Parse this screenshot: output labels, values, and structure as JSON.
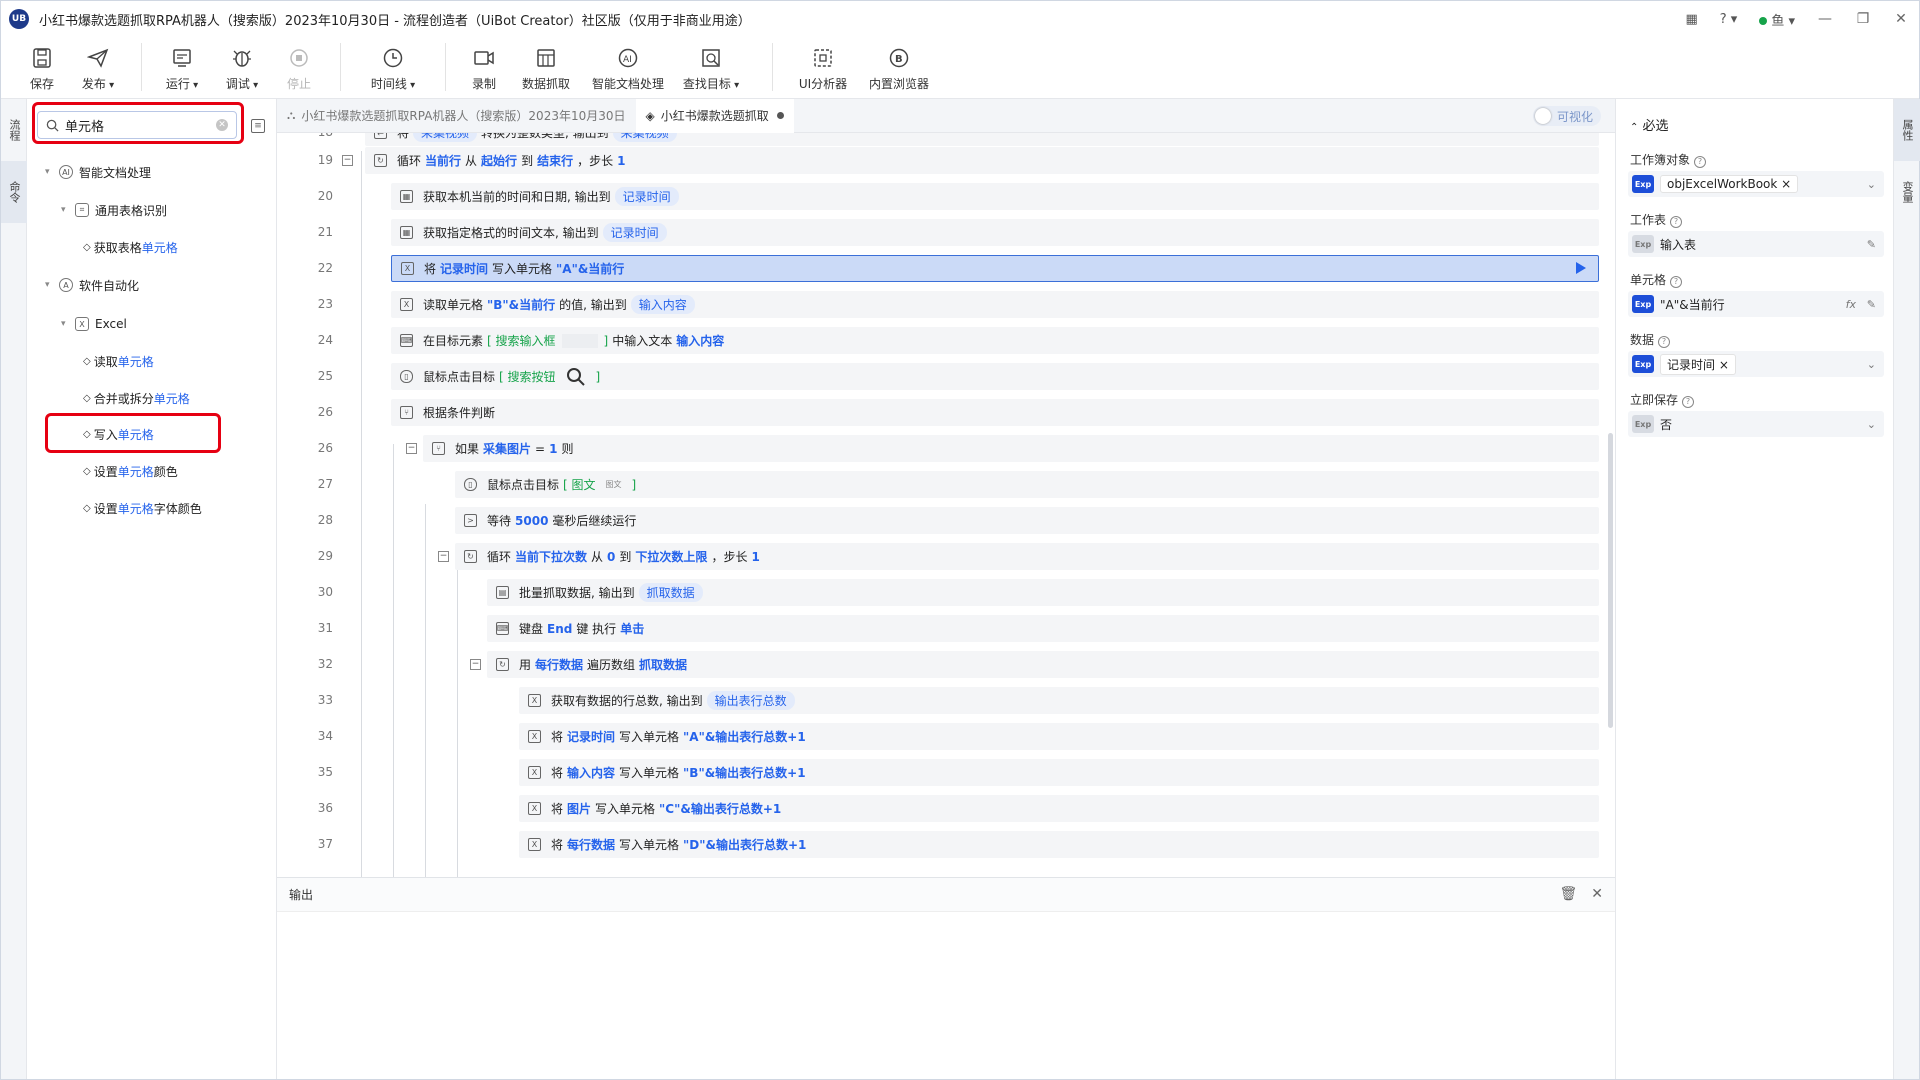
{
  "window": {
    "logo": "UB",
    "title": "小红书爆款选题抓取RPA机器人（搜索版）2023年10月30日 - 流程创造者（UiBot Creator）社区版（仅用于非商业用途）",
    "user": "鱼",
    "help": "?"
  },
  "toolbar": {
    "save": "保存",
    "publish": "发布",
    "run": "运行",
    "debug": "调试",
    "stop": "停止",
    "timeline": "时间线",
    "record": "录制",
    "data_scrape": "数据抓取",
    "smart_doc": "智能文档处理",
    "find_target": "查找目标",
    "ui_analyzer": "UI分析器",
    "browser": "内置浏览器"
  },
  "left_strip": {
    "tab1": "流程",
    "tab2": "命令"
  },
  "right_strip": {
    "tab1": "属性",
    "tab2": "变量"
  },
  "search": {
    "value": "单元格"
  },
  "tree": [
    {
      "id": "t1",
      "prefix": "智能文档处理",
      "highlight": "",
      "suffix": ""
    },
    {
      "id": "t2",
      "prefix": "通用表格识别",
      "highlight": "",
      "suffix": ""
    },
    {
      "id": "t3",
      "prefix": "获取表格",
      "highlight": "单元格",
      "suffix": ""
    },
    {
      "id": "t4",
      "prefix": "软件自动化",
      "highlight": "",
      "suffix": ""
    },
    {
      "id": "t5",
      "prefix": "Excel",
      "highlight": "",
      "suffix": ""
    },
    {
      "id": "t6",
      "prefix": "读取",
      "highlight": "单元格",
      "suffix": ""
    },
    {
      "id": "t7",
      "prefix": "合并或拆分",
      "highlight": "单元格",
      "suffix": ""
    },
    {
      "id": "t8",
      "prefix": "写入",
      "highlight": "单元格",
      "suffix": ""
    },
    {
      "id": "t9",
      "prefix": "设置",
      "highlight": "单元格",
      "suffix": "颜色"
    },
    {
      "id": "t10",
      "prefix": "设置",
      "highlight": "单元格",
      "suffix": "字体颜色"
    }
  ],
  "tabs": {
    "main": "小红书爆款选题抓取RPA机器人（搜索版）2023年10月30日",
    "sub": "小红书爆款选题抓取",
    "visual": "可视化"
  },
  "code": {
    "r18": {
      "ln": "18",
      "a": "将",
      "v1": "采集视频",
      "b": "转换为整数类型, 输出到",
      "v2": "采集视频"
    },
    "r19": {
      "ln": "19",
      "a": "循环",
      "k1": "当前行",
      "b": "从",
      "k2": "起始行",
      "c": "到",
      "k3": "结束行",
      "d": "，步长",
      "k4": "1"
    },
    "r20": {
      "ln": "20",
      "a": "获取本机当前的时间和日期, 输出到",
      "v1": "记录时间"
    },
    "r21": {
      "ln": "21",
      "a": "获取指定格式的时间文本, 输出到",
      "v1": "记录时间"
    },
    "r22": {
      "ln": "22",
      "a": "将",
      "k1": "记录时间",
      "b": "写入单元格",
      "k2": "\"A\"&当前行"
    },
    "r23": {
      "ln": "23",
      "a": "读取单元格",
      "k1": "\"B\"&当前行",
      "b": "的值, 输出到",
      "v1": "输入内容"
    },
    "r24": {
      "ln": "24",
      "a": "在目标元素",
      "g1": "[ 搜索输入框",
      "g2": "]",
      "b": "中输入文本",
      "k1": "输入内容"
    },
    "r25": {
      "ln": "25",
      "a": "鼠标点击目标",
      "g1": "[ 搜索按钮",
      "g2": "]"
    },
    "r26a": {
      "ln": "26",
      "a": "根据条件判断"
    },
    "r26b": {
      "ln": "26",
      "a": "如果",
      "k1": "采集图片",
      "b": "=",
      "k2": "1",
      "c": "则"
    },
    "r27": {
      "ln": "27",
      "a": "鼠标点击目标",
      "g1": "[ 图文",
      "small": "图文",
      "g2": "]"
    },
    "r28": {
      "ln": "28",
      "a": "等待",
      "k1": "5000",
      "b": "毫秒后继续运行"
    },
    "r29": {
      "ln": "29",
      "a": "循环",
      "k1": "当前下拉次数",
      "b": "从",
      "k2": "0",
      "c": "到",
      "k3": "下拉次数上限",
      "d": "，步长",
      "k4": "1"
    },
    "r30": {
      "ln": "30",
      "a": "批量抓取数据, 输出到",
      "v1": "抓取数据"
    },
    "r31": {
      "ln": "31",
      "a": "键盘",
      "k1": "End",
      "b": "键 执行",
      "k2": "单击"
    },
    "r32": {
      "ln": "32",
      "a": "用",
      "k1": "每行数据",
      "b": "遍历数组",
      "k2": "抓取数据"
    },
    "r33": {
      "ln": "33",
      "a": "获取有数据的行总数, 输出到",
      "v1": "输出表行总数"
    },
    "r34": {
      "ln": "34",
      "a": "将",
      "k1": "记录时间",
      "b": "写入单元格",
      "k2": "\"A\"&输出表行总数+1"
    },
    "r35": {
      "ln": "35",
      "a": "将",
      "k1": "输入内容",
      "b": "写入单元格",
      "k2": "\"B\"&输出表行总数+1"
    },
    "r36": {
      "ln": "36",
      "a": "将",
      "k1": "图片",
      "b": "写入单元格",
      "k2": "\"C\"&输出表行总数+1"
    },
    "r37": {
      "ln": "37",
      "a": "将",
      "k1": "每行数据",
      "b": "写入单元格",
      "k2": "\"D\"&输出表行总数+1"
    }
  },
  "output": {
    "title": "输出"
  },
  "props": {
    "section": "必选",
    "exp": "Exp",
    "workbook_label": "工作簿对象",
    "workbook_value": "objExcelWorkBook",
    "sheet_label": "工作表",
    "sheet_value": "输入表",
    "cell_label": "单元格",
    "cell_value": "\"A\"&当前行",
    "fx": "fx",
    "data_label": "数据",
    "data_value": "记录时间",
    "save_label": "立即保存",
    "save_value": "否"
  },
  "colors": {
    "accent": "#2563eb",
    "highlight_box": "#e60012",
    "selected_row": "#cbdaf7"
  }
}
